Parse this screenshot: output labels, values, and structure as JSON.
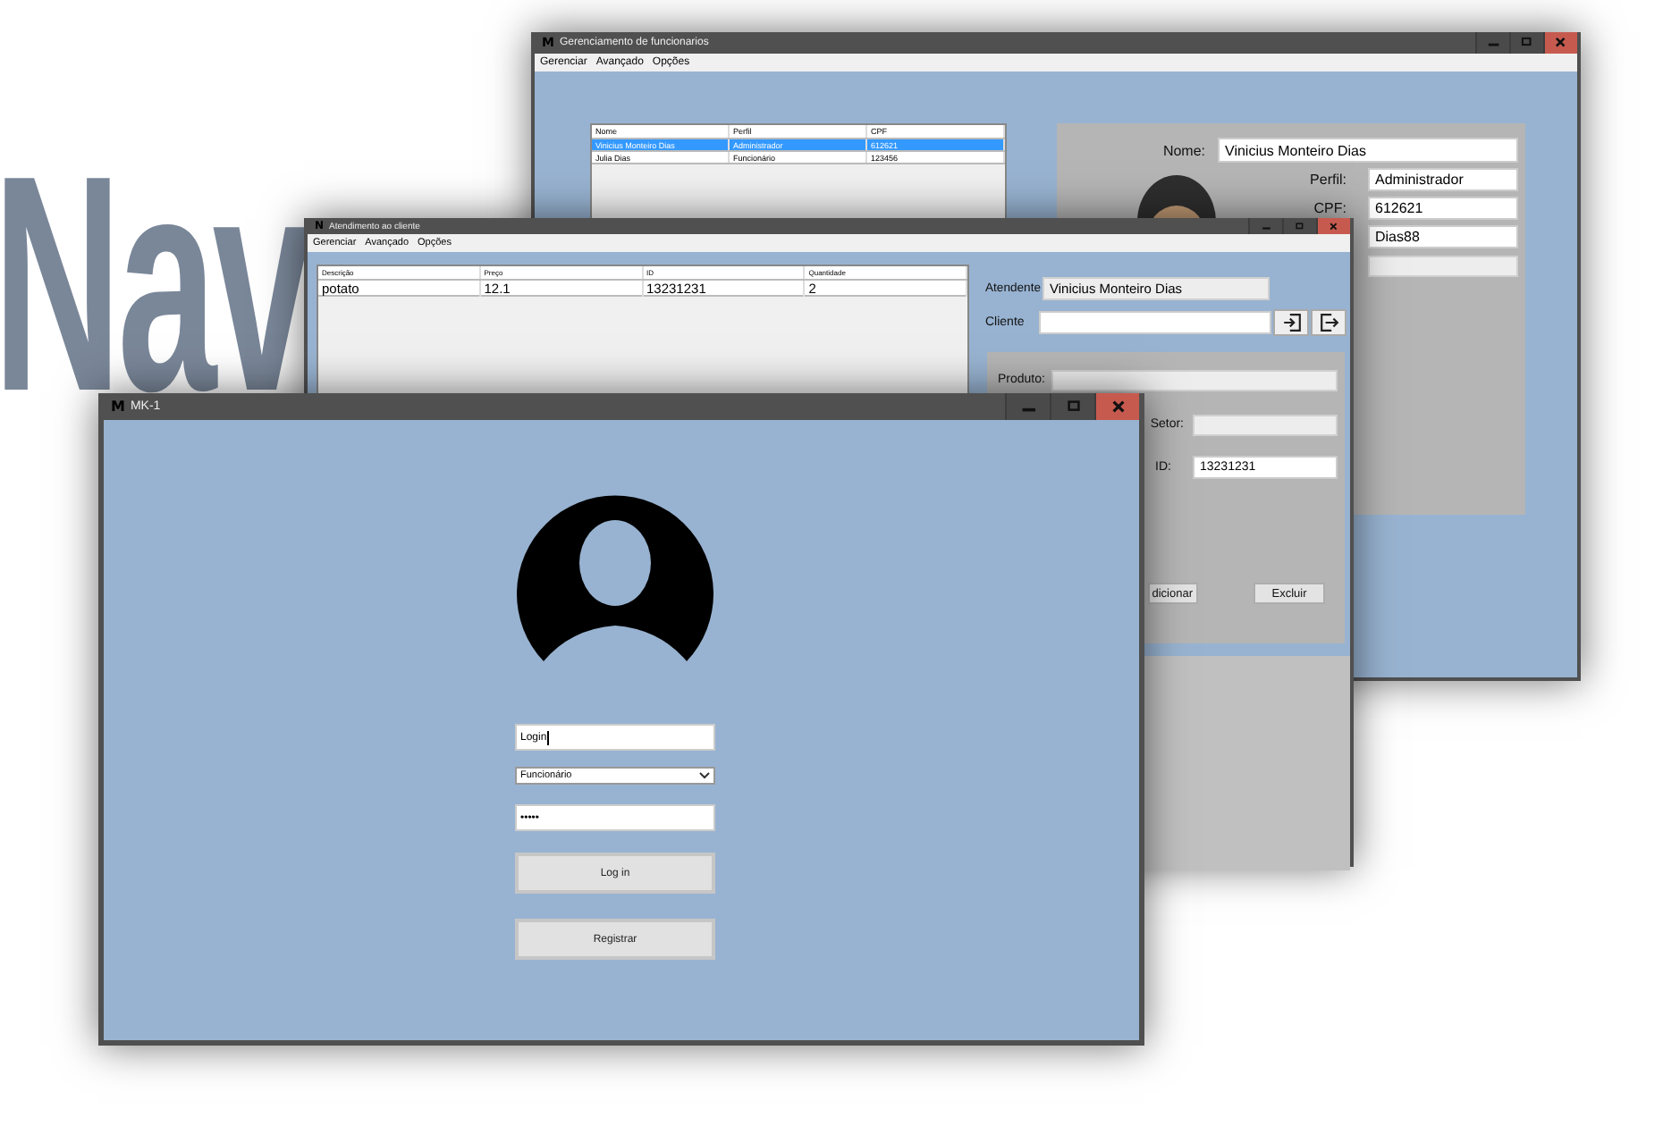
{
  "background_text": "Nav",
  "employee_window": {
    "logo": "M",
    "title": "Gerenciamento de funcionarios",
    "menu": [
      "Gerenciar",
      "Avançado",
      "Opções"
    ],
    "table": {
      "columns": [
        "Nome",
        "Perfil",
        "CPF"
      ],
      "rows": [
        {
          "cells": [
            "Vinicius Monteiro Dias",
            "Administrador",
            "612621"
          ],
          "selected": true
        },
        {
          "cells": [
            "Julia Dias",
            "Funcionário",
            "123456"
          ],
          "selected": false
        }
      ]
    },
    "form": [
      {
        "kind": "wide",
        "label": "Nome:",
        "value": "Vinicius Monteiro Dias"
      },
      {
        "kind": "short",
        "label": "Perfil:",
        "value": "Administrador"
      },
      {
        "kind": "short",
        "label": "CPF:",
        "value": "612621"
      },
      {
        "kind": "short",
        "value": "Dias88"
      },
      {
        "kind": "disabled"
      }
    ]
  },
  "service_window": {
    "logo": "N",
    "title": "Atendimento ao cliente",
    "menu": [
      "Gerenciar",
      "Avançado",
      "Opções"
    ],
    "table": {
      "columns": [
        "Descrição",
        "Preço",
        "ID",
        "Quantidade"
      ],
      "rows": [
        {
          "cells": [
            "potato",
            "12.1",
            "13231231",
            "2"
          ]
        }
      ]
    },
    "attendant": {
      "label": "Atendente",
      "value": "Vinicius Monteiro Dias"
    },
    "client": {
      "label": "Cliente"
    },
    "product": {
      "label": "Produto:"
    },
    "sector": {
      "label": "Setor:"
    },
    "id": {
      "label": "ID:",
      "value": "13231231"
    },
    "buttons": [
      "dicionar",
      "Excluir"
    ]
  },
  "login_window": {
    "logo": "M",
    "title": "MK-1",
    "login": {
      "value": "Login"
    },
    "profile": {
      "value": "Funcionário"
    },
    "password": {
      "value": "•••••"
    },
    "buttons": [
      "Log in",
      "Registrar"
    ]
  }
}
